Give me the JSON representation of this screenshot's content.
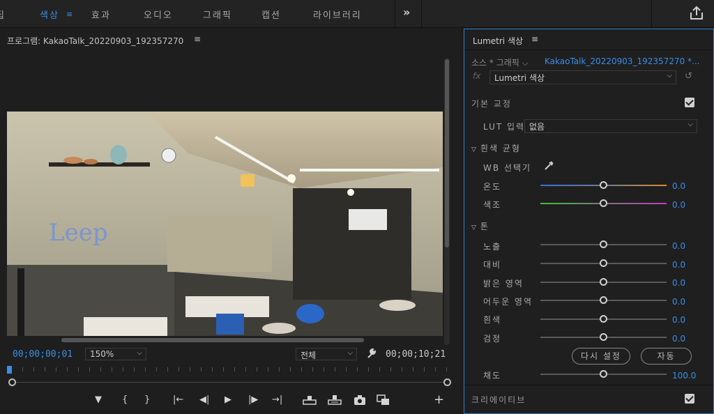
{
  "workspace": {
    "tabs": [
      "집",
      "색상",
      "효과",
      "오디오",
      "그래픽",
      "캡션",
      "라이브러리"
    ],
    "menu_glyph": "≡",
    "more_glyph": "»",
    "share_icon": "share-icon"
  },
  "program": {
    "title": "프로그램: KakaoTalk_20220903_192357270",
    "menu_glyph": "≡",
    "timecode_current": "00;00;00;01",
    "timecode_duration": "00;00;10;21",
    "zoom": "150%",
    "fit": "전체",
    "transport": [
      "▼",
      "{",
      "}",
      "|←",
      "◀|",
      "▶",
      "|▶",
      "→|",
      "lift",
      "extract",
      "camera",
      "compare",
      "+"
    ]
  },
  "lumetri": {
    "title": "Lumetri 색상",
    "menu_glyph": "≡",
    "source_label": "소스 * 그래픽",
    "clip_label": "KakaoTalk_20220903_192357270 *...",
    "fx_label": "fx",
    "effect_name": "Lumetri 색상",
    "basic_correction": {
      "title": "기본 교정",
      "enabled": true,
      "lut_label": "LUT 입력",
      "lut_value": "없음",
      "wb_title": "흰색 균형",
      "wb_picker_label": "WB 선택기",
      "temperature_label": "온도",
      "temperature_value": "0.0",
      "tint_label": "색조",
      "tint_value": "0.0",
      "tone_title": "톤",
      "exposure_label": "노출",
      "exposure_value": "0.0",
      "contrast_label": "대비",
      "contrast_value": "0.0",
      "highlights_label": "밝은 영역",
      "highlights_value": "0.0",
      "shadows_label": "어두운 영역",
      "shadows_value": "0.0",
      "whites_label": "흰색",
      "whites_value": "0.0",
      "blacks_label": "검정",
      "blacks_value": "0.0",
      "reset_label": "다시 설정",
      "auto_label": "자동",
      "saturation_label": "채도",
      "saturation_value": "100.0"
    },
    "creative": {
      "title": "크리에이티브",
      "enabled": true
    }
  },
  "colors": {
    "accent": "#3a8ee6",
    "temperature_left": "#3b6fd6",
    "temperature_right": "#e08b2a",
    "tint_left": "#3ec03e",
    "tint_right": "#c33ac3"
  }
}
